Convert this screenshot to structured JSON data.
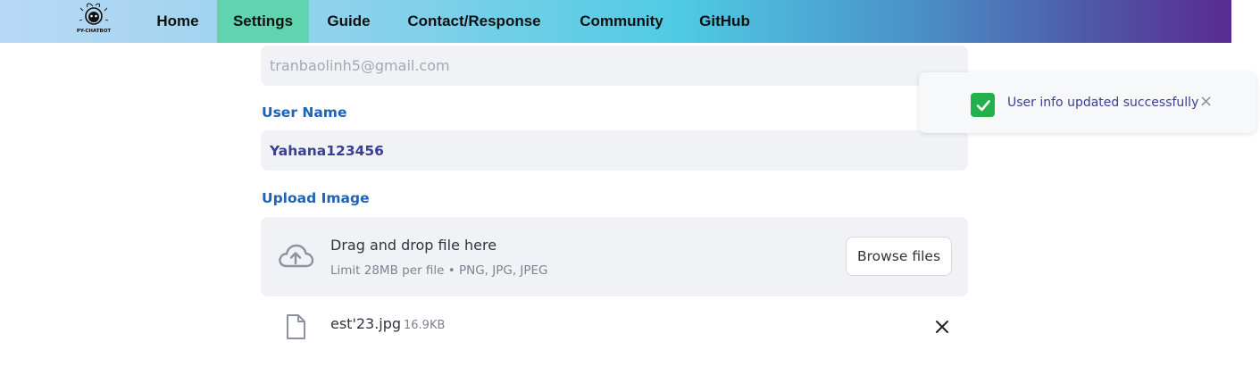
{
  "nav": {
    "logo_text": "PY-CHATBOT",
    "items": [
      {
        "label": "Home"
      },
      {
        "label": "Settings",
        "active": true
      },
      {
        "label": "Guide"
      },
      {
        "label": "Contact/Response"
      },
      {
        "label": "Community"
      },
      {
        "label": "GitHub"
      }
    ]
  },
  "form": {
    "email_value": "tranbaolinh5@gmail.com",
    "username_label": "User Name",
    "username_value": "Yahana123456",
    "upload_label": "Upload Image",
    "dropzone_title": "Drag and drop file here",
    "dropzone_limit": "Limit 28MB per file • PNG, JPG, JPEG",
    "browse_label": "Browse files",
    "file_name": "est'23.jpg",
    "file_size": "16.9KB"
  },
  "toast": {
    "message": "User info updated successfully",
    "close_glyph": "×"
  },
  "colors": {
    "accent_label": "#1d63b8",
    "active_tab": "#5fd4ae",
    "success": "#22b14c"
  }
}
